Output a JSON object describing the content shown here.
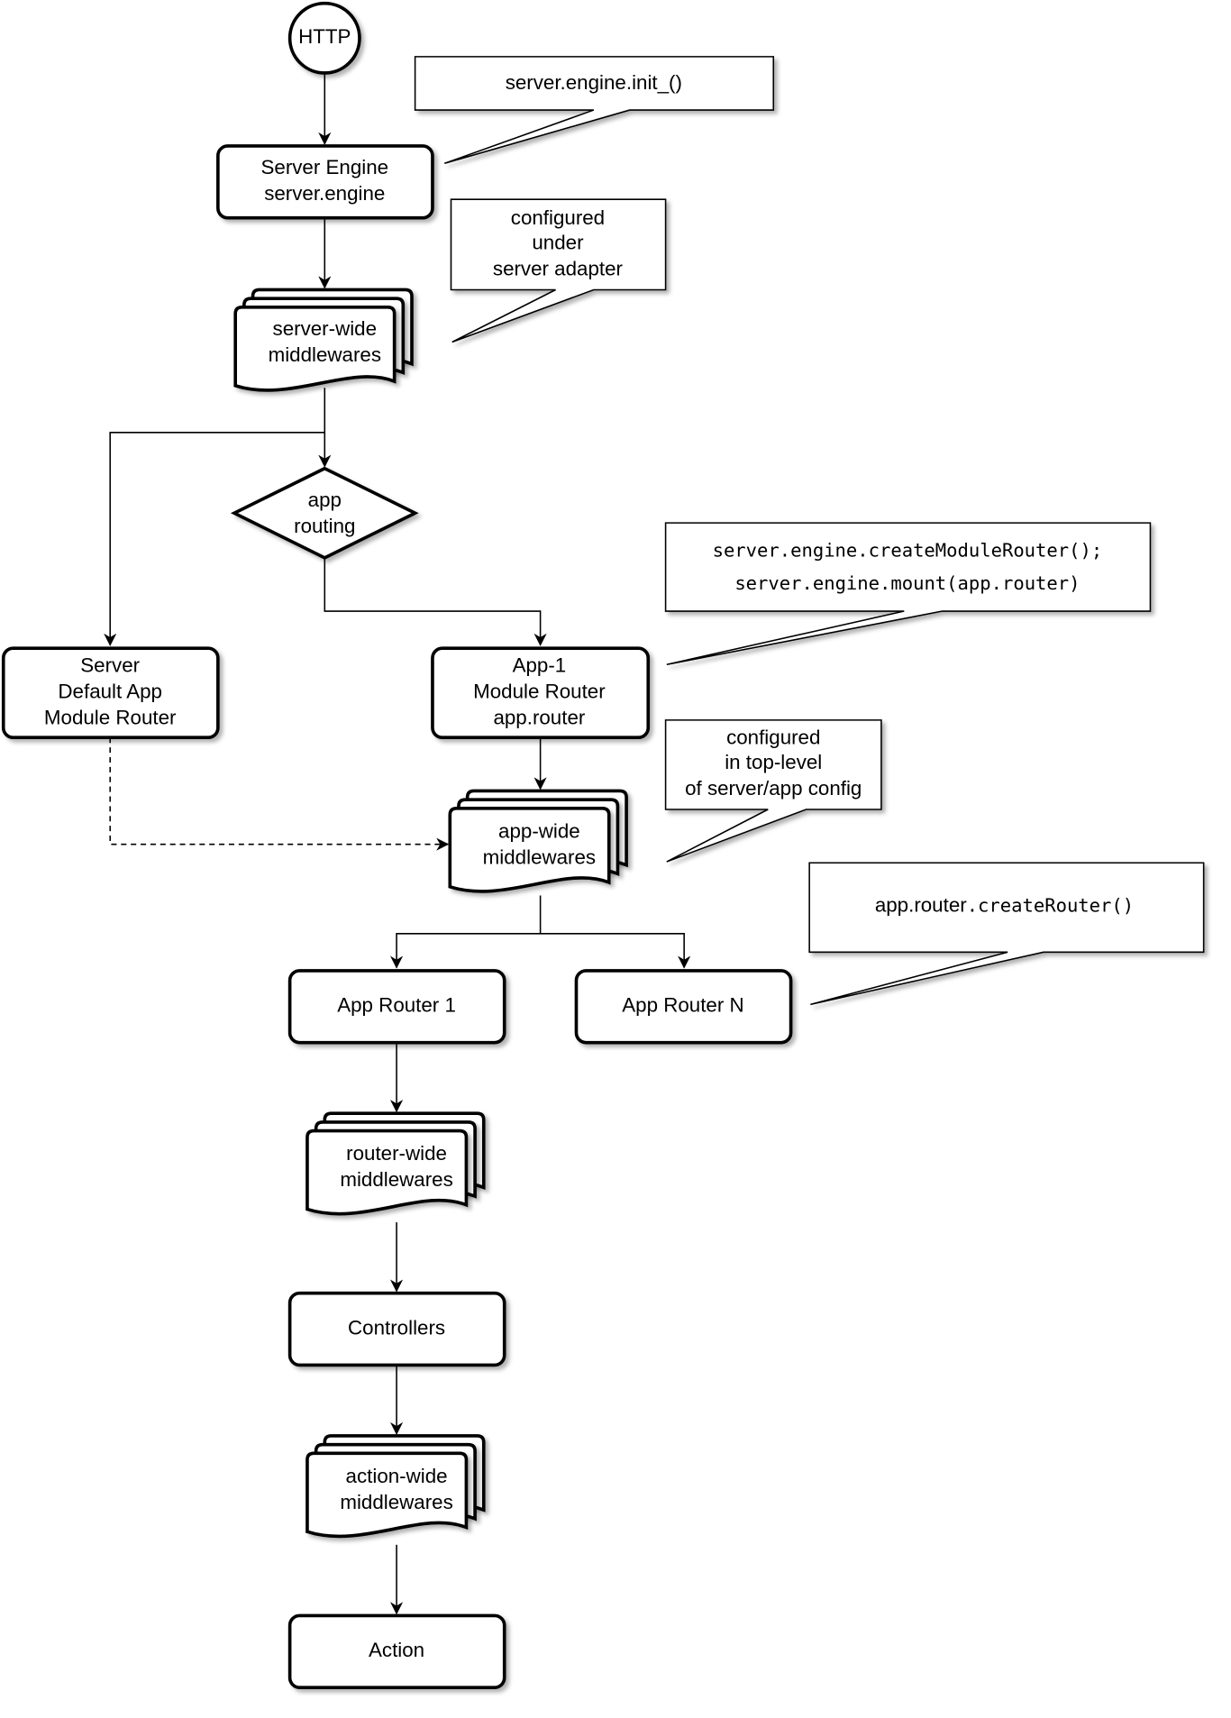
{
  "nodes": {
    "http": {
      "label": "HTTP"
    },
    "server_engine": {
      "lines": [
        "Server Engine",
        "server.engine"
      ]
    },
    "server_wide": {
      "lines": [
        "server-wide",
        "middlewares"
      ]
    },
    "app_routing": {
      "lines": [
        "app",
        "routing"
      ]
    },
    "server_default": {
      "lines": [
        "Server",
        "Default App",
        "Module Router"
      ]
    },
    "app1": {
      "lines": [
        "App-1",
        "Module Router",
        "app.router"
      ]
    },
    "app_wide": {
      "lines": [
        "app-wide",
        "middlewares"
      ]
    },
    "app_router_1": {
      "label": "App Router 1"
    },
    "app_router_n": {
      "label": "App Router N"
    },
    "router_wide": {
      "lines": [
        "router-wide",
        "middlewares"
      ]
    },
    "controllers": {
      "label": "Controllers"
    },
    "action_wide": {
      "lines": [
        "action-wide",
        "middlewares"
      ]
    },
    "action": {
      "label": "Action"
    }
  },
  "callouts": {
    "engine_init": {
      "label": "server.engine.init_()"
    },
    "server_adapter": {
      "lines": [
        "configured",
        "under",
        "server adapter"
      ]
    },
    "module_router": {
      "lines": [
        "server.engine.createModuleRouter();",
        "server.engine.mount(app.router)"
      ]
    },
    "top_level": {
      "lines": [
        "configured",
        "in top-level",
        "of server/app config"
      ]
    },
    "create_router": {
      "prefix": "app.router",
      "code": ".createRouter()"
    }
  },
  "colors": {
    "stroke": "#000000",
    "fill": "#ffffff"
  }
}
